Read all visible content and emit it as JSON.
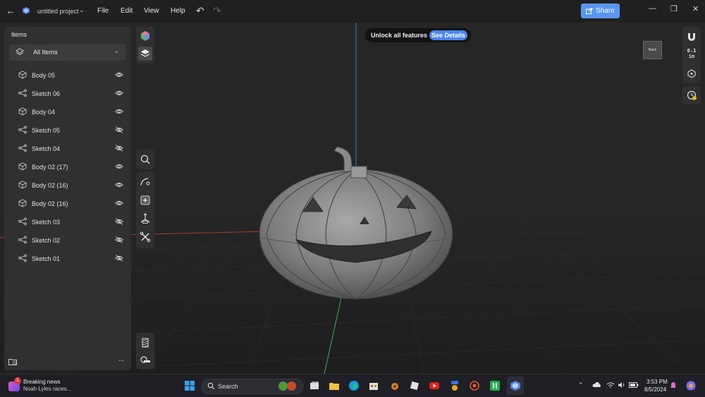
{
  "titlebar": {
    "project_name": "untitled project",
    "menu": [
      "File",
      "Edit",
      "View",
      "Help"
    ],
    "share_label": "Share",
    "icons": [
      "back-arrow-icon",
      "app-logo-icon",
      "undo-icon",
      "redo-icon",
      "share-icon",
      "minimize-icon",
      "maximize-icon",
      "close-icon"
    ]
  },
  "panel": {
    "title": "Items",
    "filter_label": "All Items",
    "items": [
      {
        "label": "Body 05",
        "type": "body",
        "visible": true
      },
      {
        "label": "Sketch 06",
        "type": "sketch",
        "visible": true
      },
      {
        "label": "Body 04",
        "type": "body",
        "visible": true
      },
      {
        "label": "Sketch 05",
        "type": "sketch",
        "visible": false
      },
      {
        "label": "Sketch 04",
        "type": "sketch",
        "visible": false
      },
      {
        "label": "Body 02 (17)",
        "type": "body",
        "visible": true
      },
      {
        "label": "Body 02 (16)",
        "type": "body",
        "visible": true
      },
      {
        "label": "Body 02 (16)",
        "type": "body",
        "visible": true
      },
      {
        "label": "Sketch 03",
        "type": "sketch",
        "visible": false
      },
      {
        "label": "Sketch 02",
        "type": "sketch",
        "visible": false
      },
      {
        "label": "Sketch 01",
        "type": "sketch",
        "visible": false
      }
    ],
    "more_label": "..."
  },
  "banner": {
    "text": "Unlock all features",
    "cta": "See Details"
  },
  "viewcube": {
    "face_label": "Back"
  },
  "right_toolbar": {
    "unit_value": "0.1",
    "unit": "in"
  },
  "taskbar": {
    "news_badge": "1",
    "news_title": "Breaking news",
    "news_subtitle": "Noah Lyles races...",
    "search_label": "Search",
    "time": "3:53 PM",
    "date": "8/5/2024"
  },
  "colors": {
    "accent": "#5b95ee",
    "banner_cta": "#4d86ea",
    "panel_bg": "#303030",
    "viewport_bg": "#262626",
    "axis_x": "#c0392b",
    "axis_y": "#3fae55",
    "axis_z": "#2f7fd8"
  }
}
